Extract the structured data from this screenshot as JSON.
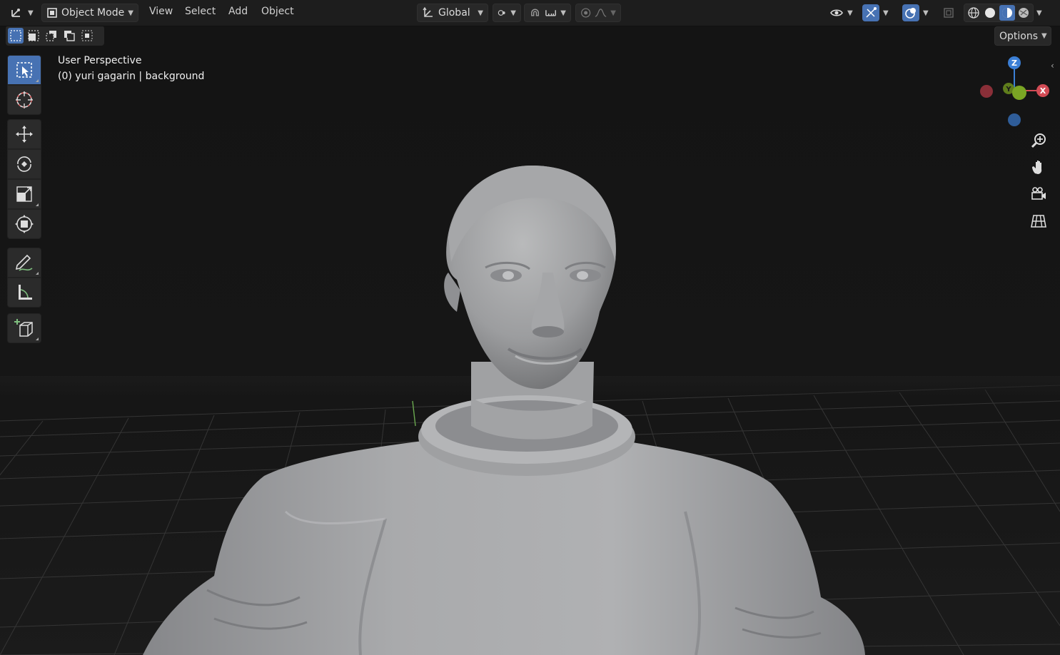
{
  "header": {
    "mode_label": "Object Mode",
    "menus": [
      "View",
      "Select",
      "Add",
      "Object"
    ],
    "transform_orientation": "Global",
    "options_label": "Options"
  },
  "viewport": {
    "perspective_label": "User Perspective",
    "object_info": "(0) yuri gagarin | background",
    "gizmo": {
      "z": "Z",
      "y": "Y",
      "x": "X"
    }
  },
  "colors": {
    "accent": "#4772b3",
    "axis_x": "#d24b55",
    "axis_y": "#7aa524",
    "axis_z": "#3b7fd6",
    "header_bg": "#1d1d1d",
    "viewport_bg": "#161616"
  },
  "icons": {
    "editor_type": "editor-type-icon",
    "select_box": "select-box-icon",
    "cursor": "cursor-icon",
    "move": "move-icon",
    "rotate": "rotate-icon",
    "scale": "scale-icon",
    "transform": "transform-icon",
    "annotate": "annotate-icon",
    "measure": "measure-icon",
    "add_cube": "add-cube-icon",
    "zoom": "zoom-icon",
    "pan": "hand-icon",
    "camera": "camera-icon",
    "ortho": "grid-ortho-icon"
  }
}
